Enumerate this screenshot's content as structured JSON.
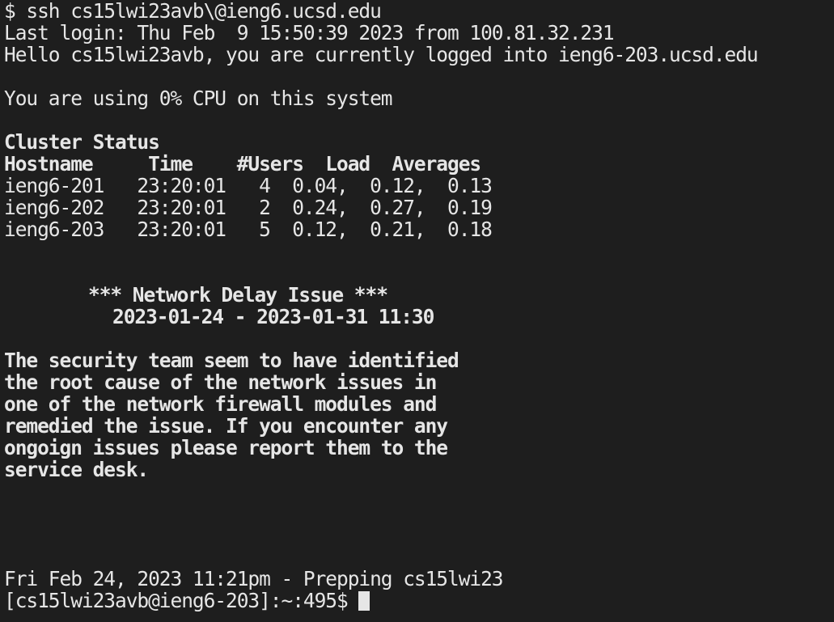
{
  "terminal": {
    "background": "#1e1e1e",
    "foreground": "#e6e6e6",
    "command_line": "$ ssh cs15lwi23avb\\@ieng6.ucsd.edu",
    "last_login": "Last login: Thu Feb  9 15:50:39 2023 from 100.81.32.231",
    "hello": "Hello cs15lwi23avb, you are currently logged into ieng6-203.ucsd.edu",
    "cpu_usage": "You are using 0% CPU on this system",
    "cluster": {
      "title": "Cluster Status",
      "header": "Hostname     Time    #Users  Load  Averages",
      "rows": [
        "ieng6-201   23:20:01   4  0.04,  0.12,  0.13",
        "ieng6-202   23:20:01   2  0.24,  0.27,  0.19",
        "ieng6-203   23:20:01   5  0.12,  0.21,  0.18"
      ]
    },
    "notice": {
      "title": "*** Network Delay Issue ***",
      "dates": "2023-01-24 - 2023-01-31 11:30",
      "body": [
        "The security team seem to have identified",
        "the root cause of the network issues in",
        "one of the network firewall modules and",
        "remedied the issue. If you encounter any",
        "ongoign issues please report them to the",
        "service desk."
      ]
    },
    "status_line": "Fri Feb 24, 2023 11:21pm - Prepping cs15lwi23",
    "prompt": "[cs15lwi23avb@ieng6-203]:~:495$ "
  }
}
